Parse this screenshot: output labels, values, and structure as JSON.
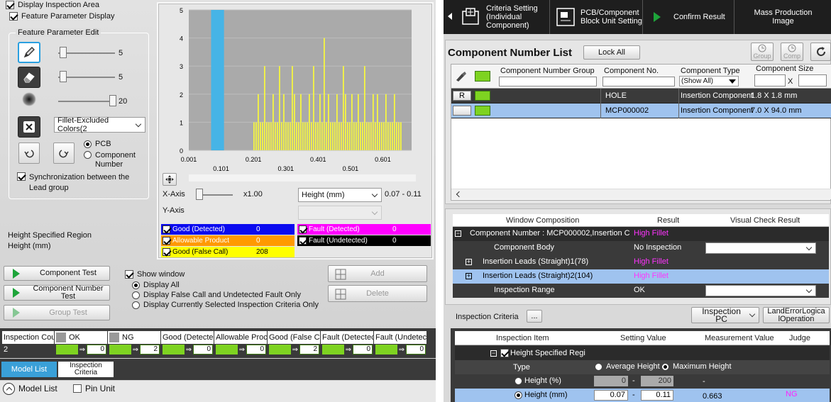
{
  "left": {
    "display_inspection_area": "Display Inspection Area",
    "feature_parameter_display": "Feature Parameter Display",
    "feature_param_edit": "Feature Parameter Edit",
    "pencil_value": "5",
    "eraser_value": "5",
    "brush_value": "20",
    "fillet_select": "Fillet-Excluded Colors(2",
    "radio_pcb": "PCB",
    "radio_component": "Component Number",
    "sync_lead": "Synchronization between the Lead group",
    "height_region": "Height Specified Region",
    "height_unit": "Height (mm)",
    "buttons": {
      "component_test": "Component Test",
      "component_number_test": "Component Number Test",
      "group_test": "Group Test",
      "add": "Add",
      "delete": "Delete"
    },
    "show_window": "Show window",
    "display_options": [
      "Display All",
      "Display False Call and Undetected Fault Only",
      "Display Currently Selected Inspection Criteria Only"
    ]
  },
  "chart": {
    "x_axis_label": "X-Axis",
    "x_zoom": "x1.00",
    "y_axis_label": "Y-Axis",
    "x_select": "Height (mm)",
    "range_text": "0.07 - 0.11",
    "legend": [
      {
        "label": "Good (Detected)",
        "value": "0",
        "color": "#0a0af0",
        "text": "#ffffff"
      },
      {
        "label": "Allowable Product",
        "value": "0",
        "color": "#ff9900",
        "text": "#ffffff"
      },
      {
        "label": "Good (False Call)",
        "value": "208",
        "color": "#ffff00",
        "text": "#000000"
      },
      {
        "label": "Fault (Detected)",
        "value": "0",
        "color": "#ff00ff",
        "text": "#ffffff"
      },
      {
        "label": "Fault (Undetected)",
        "value": "0",
        "color": "#000000",
        "text": "#ffffff"
      }
    ]
  },
  "chart_data": {
    "type": "bar",
    "ylim": [
      0,
      5
    ],
    "y_ticks": [
      "0",
      "1",
      "2",
      "3",
      "4",
      "5"
    ],
    "x_ticks_top": [
      "0.001",
      "0.201",
      "0.401",
      "0.601"
    ],
    "x_ticks_bottom": [
      "0.101",
      "0.301",
      "0.501"
    ],
    "xlim": [
      0.001,
      0.69
    ],
    "highlight_range": [
      0.07,
      0.11
    ],
    "series": [
      {
        "values": [
          1,
          1,
          2,
          1,
          1,
          3,
          1,
          1,
          1,
          2,
          1,
          1,
          3,
          1,
          2,
          1,
          1,
          1,
          3,
          2,
          1,
          1,
          2,
          1,
          1,
          1,
          2,
          1,
          3,
          1,
          1,
          2,
          1,
          4,
          1,
          2,
          1,
          1,
          1,
          2,
          1,
          1,
          3,
          2,
          1,
          1,
          2,
          1,
          1,
          2,
          1,
          1,
          3,
          1,
          1,
          1,
          2,
          1,
          2,
          1,
          1,
          1,
          2,
          1,
          1,
          1,
          2,
          1,
          1,
          1
        ]
      }
    ],
    "series_x_start": 0.201,
    "series_x_end": 0.655
  },
  "counts": {
    "headers": [
      "Inspection Cou",
      "OK",
      "NG",
      "Good (Detecte",
      "Allowable Proc",
      "Good (False Ca",
      "Fault (Detectec",
      "Fault (Undetec"
    ],
    "values": [
      "2",
      "0",
      "2",
      "0",
      "0",
      "2",
      "0",
      "0"
    ]
  },
  "tabs": {
    "model_list": "Model List",
    "inspection_criteria": "Inspection Criteria"
  },
  "model_list": {
    "title": "Model List",
    "pin_unit": "Pin Unit"
  },
  "toolbar": {
    "criteria_setting": "Criteria Setting (Individual Component)",
    "pcb_block": "PCB/Component Block Unit Setting",
    "confirm_result": "Confirm Result",
    "mass_production": "Mass Production Image"
  },
  "component_list": {
    "title": "Component Number List",
    "lock_all": "Lock All",
    "group_btn": "Group",
    "comp_btn": "Comp",
    "columns": [
      "Component Number Group",
      "Component No.",
      "Component Type",
      "Component Size"
    ],
    "type_filter": "(Show All)",
    "size_x": "X",
    "rows": [
      {
        "tag": "R",
        "group": "",
        "no": "HOLE",
        "type": "Insertion Component",
        "size": "1.8 X 1.8 mm"
      },
      {
        "tag": "",
        "group": "",
        "no": "MCP000002",
        "type": "Insertion Component",
        "size": "7.0 X 94.0 mm"
      }
    ]
  },
  "window_comp": {
    "columns": [
      "Window Composition",
      "Result",
      "Visual Check Result"
    ],
    "rows": [
      {
        "name": "Component Number : MCP000002,Insertion C",
        "result": "High Fillet",
        "result_color": "#ff33ff",
        "has_select": false
      },
      {
        "name": "Component Body",
        "result": "No Inspection",
        "result_color": "#ffffff",
        "has_select": true
      },
      {
        "name": "Insertion Leads (Straight)1(78)",
        "result": "High Fillet",
        "result_color": "#ff33ff",
        "has_select": false
      },
      {
        "name": "Insertion Leads (Straight)2(104)",
        "result": "High Fillet",
        "result_color": "#ff33ff",
        "has_select": false
      },
      {
        "name": "Inspection Range",
        "result": "OK",
        "result_color": "#ffffff",
        "has_select": true
      }
    ]
  },
  "inspection_criteria": {
    "label": "Inspection Criteria",
    "more": "...",
    "inspection_pc": "Inspection PC",
    "land_error": "LandErrorLogica lOperation",
    "columns": [
      "Inspection Item",
      "Setting Value",
      "Measurement Value",
      "Judge"
    ],
    "height_region": "Height Specified Regi",
    "type_label": "Type",
    "average_height": "Average Height",
    "maximum_height": "Maximum Height",
    "height_pct": "Height (%)",
    "pct_min": "0",
    "pct_max": "200",
    "pct_measure": "-",
    "height_mm": "Height (mm)",
    "mm_min": "0.07",
    "mm_max": "0.11",
    "mm_measure": "0.663",
    "judge": "NG",
    "dash": "-"
  }
}
